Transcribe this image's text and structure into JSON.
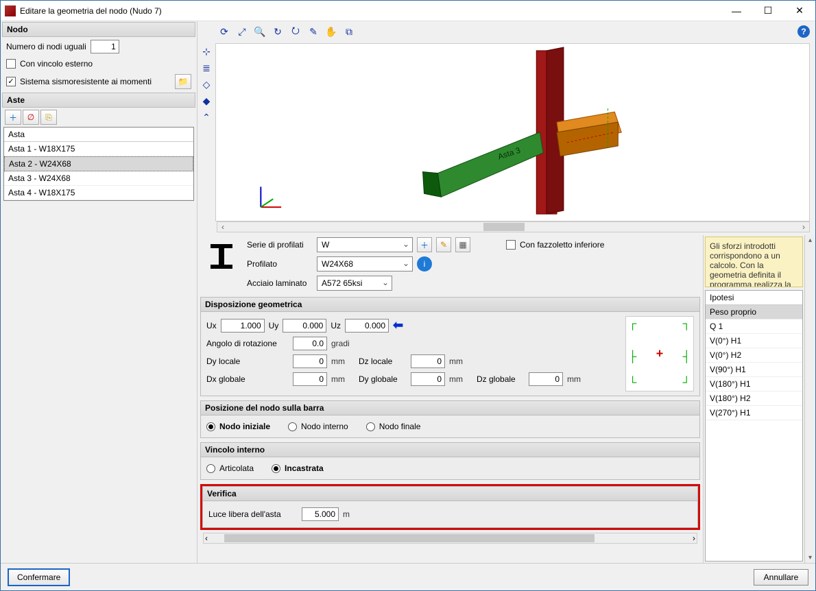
{
  "window": {
    "title": "Editare la geometria del nodo (Nudo 7)"
  },
  "nodo": {
    "header": "Nodo",
    "num_label": "Numero di nodi uguali",
    "num_value": "1",
    "chk_vincolo": "Con vincolo esterno",
    "chk_sismo": "Sistema sismoresistente ai momenti"
  },
  "aste": {
    "header": "Aste",
    "col": "Asta",
    "items": [
      "Asta 1 - W18X175",
      "Asta 2 - W24X68",
      "Asta 3 - W24X68",
      "Asta 4 - W18X175"
    ],
    "selected_index": 1,
    "viewport_label": "Asta 3"
  },
  "profilati": {
    "serie_lbl": "Serie di profilati",
    "serie_val": "W",
    "profilato_lbl": "Profilato",
    "profilato_val": "W24X68",
    "acciaio_lbl": "Acciaio laminato",
    "acciaio_val": "A572 65ksi",
    "chk_fazzoletto": "Con fazzoletto inferiore"
  },
  "disposizione": {
    "header": "Disposizione geometrica",
    "ux_lbl": "Ux",
    "ux": "1.000",
    "uy_lbl": "Uy",
    "uy": "0.000",
    "uz_lbl": "Uz",
    "uz": "0.000",
    "angolo_lbl": "Angolo di rotazione",
    "angolo": "0.0",
    "angolo_unit": "gradi",
    "dy_loc_lbl": "Dy locale",
    "dy_loc": "0",
    "dz_loc_lbl": "Dz locale",
    "dz_loc": "0",
    "dx_glo_lbl": "Dx globale",
    "dx_glo": "0",
    "dy_glo_lbl": "Dy globale",
    "dy_glo": "0",
    "dz_glo_lbl": "Dz globale",
    "dz_glo": "0",
    "mm": "mm"
  },
  "posizione": {
    "header": "Posizione del nodo sulla barra",
    "iniziale": "Nodo iniziale",
    "interno": "Nodo interno",
    "finale": "Nodo finale"
  },
  "vincolo": {
    "header": "Vincolo interno",
    "articolata": "Articolata",
    "incastrata": "Incastrata"
  },
  "verifica": {
    "header": "Verifica",
    "luce_lbl": "Luce libera dell'asta",
    "luce": "5.000",
    "unit": "m"
  },
  "hint": "Gli sforzi introdotti corrispondono a un calcolo. Con la geometria definita il programma realizza la verifica per l'unione.",
  "ipotesi": {
    "header": "Ipotesi",
    "items": [
      "Peso proprio",
      "Q 1",
      "V(0°) H1",
      "V(0°) H2",
      "V(90°) H1",
      "V(180°) H1",
      "V(180°) H2",
      "V(270°) H1"
    ],
    "selected_index": 0
  },
  "buttons": {
    "ok": "Confermare",
    "cancel": "Annullare"
  }
}
